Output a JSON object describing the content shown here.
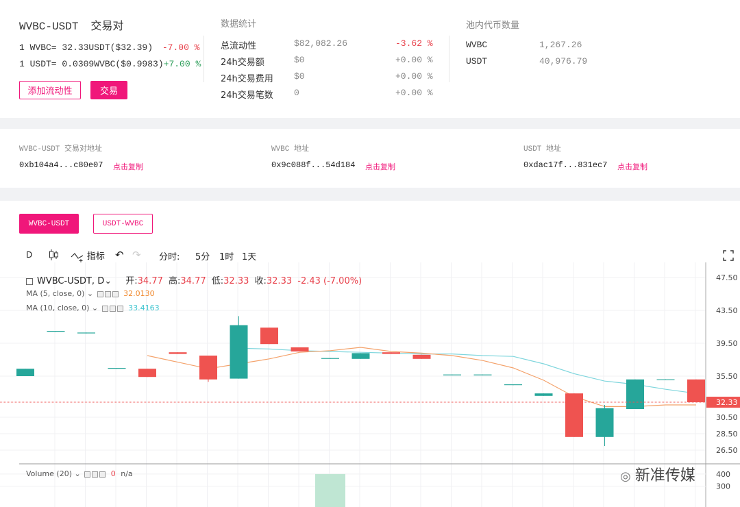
{
  "pair": {
    "name": "WVBC-USDT",
    "suffix": "交易对",
    "rate1_prefix": "1 WVBC= 32.33USDT($32.39)",
    "rate1_change": "-7.00 %",
    "rate2_prefix": "1 USDT= 0.0309WVBC($0.9983)",
    "rate2_change": "+7.00 %",
    "add_liquidity_label": "添加流动性",
    "trade_label": "交易"
  },
  "stats": {
    "title": "数据统计",
    "rows": [
      {
        "label": "总流动性",
        "value": "$82,082.26",
        "change": "-3.62 %"
      },
      {
        "label": "24h交易额",
        "value": "$0",
        "change": "+0.00 %"
      },
      {
        "label": "24h交易费用",
        "value": "$0",
        "change": "+0.00 %"
      },
      {
        "label": "24h交易笔数",
        "value": "0",
        "change": "+0.00 %"
      }
    ]
  },
  "pool": {
    "title": "池内代币数量",
    "rows": [
      {
        "token": "WVBC",
        "amount": "1,267.26"
      },
      {
        "token": "USDT",
        "amount": "40,976.79"
      }
    ]
  },
  "addresses": [
    {
      "label": "WVBC-USDT 交易对地址",
      "value": "0xb104a4...c80e07",
      "copy": "点击复制"
    },
    {
      "label": "WVBC 地址",
      "value": "0x9c088f...54d184",
      "copy": "点击复制"
    },
    {
      "label": "USDT 地址",
      "value": "0xdac17f...831ec7",
      "copy": "点击复制"
    }
  ],
  "chart_tabs": [
    "WVBC-USDT",
    "USDT-WVBC"
  ],
  "toolbar": {
    "interval": "D",
    "indicators": "指标",
    "time_label": "分时:",
    "t1": "5分",
    "t2": "1时",
    "t3": "1天"
  },
  "legend": {
    "symbol": "WVBC-USDT, D",
    "open_label": "开:",
    "open": "34.77",
    "high_label": "高:",
    "high": "34.77",
    "low_label": "低:",
    "low": "32.33",
    "close_label": "收:",
    "close": "32.33",
    "change": "-2.43 (-7.00%)",
    "ma5_label": "MA (5, close, 0)",
    "ma5_value": "32.0130",
    "ma10_label": "MA (10, close, 0)",
    "ma10_value": "33.4163",
    "volume_label": "Volume (20)",
    "volume_value": "0",
    "volume_na": "n/a"
  },
  "watermark": "新准传媒",
  "colors": {
    "accent": "#f0177a",
    "up": "#26a69a",
    "down": "#ef5350",
    "ma5": "#f4a26b",
    "ma10": "#7fd6dd"
  },
  "chart_data": {
    "type": "candlestick",
    "price_axis_ticks": [
      "47.50",
      "43.50",
      "39.50",
      "35.50",
      "32.33",
      "30.50",
      "28.50",
      "26.50"
    ],
    "volume_axis_ticks": [
      "400",
      "300"
    ],
    "ylim": [
      25.0,
      48.5
    ],
    "last_price": 32.33,
    "candles": [
      {
        "o": 35.5,
        "c": 36.4,
        "h": 36.4,
        "l": 35.5
      },
      {
        "o": 40.9,
        "c": 41.0,
        "h": 41.0,
        "l": 40.9
      },
      {
        "o": 40.7,
        "c": 40.8,
        "h": 40.8,
        "l": 40.7
      },
      {
        "o": 36.4,
        "c": 36.5,
        "h": 36.5,
        "l": 36.4
      },
      {
        "o": 36.4,
        "c": 35.4,
        "h": 36.4,
        "l": 35.4
      },
      {
        "o": 38.4,
        "c": 38.2,
        "h": 38.4,
        "l": 38.2
      },
      {
        "o": 38.0,
        "c": 35.1,
        "h": 38.0,
        "l": 34.8
      },
      {
        "o": 35.2,
        "c": 41.7,
        "h": 42.8,
        "l": 35.2
      },
      {
        "o": 41.4,
        "c": 39.4,
        "h": 41.4,
        "l": 39.4
      },
      {
        "o": 39.0,
        "c": 38.5,
        "h": 39.0,
        "l": 38.5
      },
      {
        "o": 37.6,
        "c": 37.7,
        "h": 37.7,
        "l": 37.6
      },
      {
        "o": 37.6,
        "c": 38.3,
        "h": 38.3,
        "l": 37.6
      },
      {
        "o": 38.4,
        "c": 38.2,
        "h": 38.4,
        "l": 38.2
      },
      {
        "o": 38.1,
        "c": 37.6,
        "h": 38.1,
        "l": 37.6
      },
      {
        "o": 35.6,
        "c": 35.7,
        "h": 35.7,
        "l": 35.6
      },
      {
        "o": 35.6,
        "c": 35.7,
        "h": 35.7,
        "l": 35.6
      },
      {
        "o": 34.4,
        "c": 34.5,
        "h": 34.5,
        "l": 34.4
      },
      {
        "o": 33.1,
        "c": 33.4,
        "h": 33.4,
        "l": 33.1
      },
      {
        "o": 33.4,
        "c": 28.1,
        "h": 33.4,
        "l": 28.1
      },
      {
        "o": 28.1,
        "c": 31.6,
        "h": 32.0,
        "l": 27.0
      },
      {
        "o": 31.5,
        "c": 35.1,
        "h": 35.1,
        "l": 31.5
      },
      {
        "o": 35.0,
        "c": 35.1,
        "h": 35.1,
        "l": 35.0
      },
      {
        "o": 35.1,
        "c": 32.33,
        "h": 35.1,
        "l": 32.33
      }
    ],
    "ma5": [
      null,
      null,
      null,
      null,
      38.0,
      37.2,
      36.4,
      37.0,
      37.6,
      38.4,
      38.6,
      39.0,
      38.5,
      38.3,
      38.0,
      37.4,
      36.5,
      35.0,
      33.0,
      31.8,
      31.8,
      32.0,
      32.0
    ],
    "ma10": [
      null,
      null,
      null,
      null,
      null,
      null,
      null,
      38.9,
      38.8,
      38.6,
      38.5,
      38.4,
      38.3,
      38.2,
      38.2,
      38.0,
      37.9,
      37.0,
      35.8,
      34.9,
      34.5,
      33.9,
      33.4
    ],
    "volume": [
      0,
      0,
      0,
      0,
      0,
      0,
      0,
      0,
      0,
      0,
      400,
      0,
      0,
      0,
      0,
      0,
      0,
      0,
      0,
      0,
      0,
      0,
      0
    ]
  }
}
